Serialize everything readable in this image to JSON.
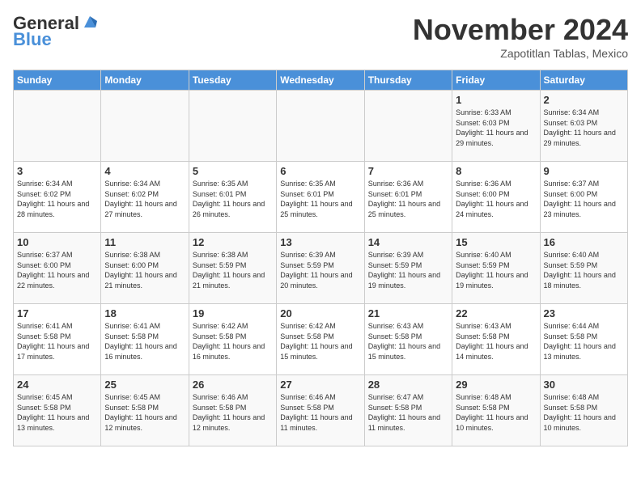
{
  "header": {
    "logo_general": "General",
    "logo_blue": "Blue",
    "month": "November 2024",
    "location": "Zapotitlan Tablas, Mexico"
  },
  "weekdays": [
    "Sunday",
    "Monday",
    "Tuesday",
    "Wednesday",
    "Thursday",
    "Friday",
    "Saturday"
  ],
  "weeks": [
    [
      {
        "day": "",
        "empty": true
      },
      {
        "day": "",
        "empty": true
      },
      {
        "day": "",
        "empty": true
      },
      {
        "day": "",
        "empty": true
      },
      {
        "day": "",
        "empty": true
      },
      {
        "day": "1",
        "sunrise": "Sunrise: 6:33 AM",
        "sunset": "Sunset: 6:03 PM",
        "daylight": "Daylight: 11 hours and 29 minutes."
      },
      {
        "day": "2",
        "sunrise": "Sunrise: 6:34 AM",
        "sunset": "Sunset: 6:03 PM",
        "daylight": "Daylight: 11 hours and 29 minutes."
      }
    ],
    [
      {
        "day": "3",
        "sunrise": "Sunrise: 6:34 AM",
        "sunset": "Sunset: 6:02 PM",
        "daylight": "Daylight: 11 hours and 28 minutes."
      },
      {
        "day": "4",
        "sunrise": "Sunrise: 6:34 AM",
        "sunset": "Sunset: 6:02 PM",
        "daylight": "Daylight: 11 hours and 27 minutes."
      },
      {
        "day": "5",
        "sunrise": "Sunrise: 6:35 AM",
        "sunset": "Sunset: 6:01 PM",
        "daylight": "Daylight: 11 hours and 26 minutes."
      },
      {
        "day": "6",
        "sunrise": "Sunrise: 6:35 AM",
        "sunset": "Sunset: 6:01 PM",
        "daylight": "Daylight: 11 hours and 25 minutes."
      },
      {
        "day": "7",
        "sunrise": "Sunrise: 6:36 AM",
        "sunset": "Sunset: 6:01 PM",
        "daylight": "Daylight: 11 hours and 25 minutes."
      },
      {
        "day": "8",
        "sunrise": "Sunrise: 6:36 AM",
        "sunset": "Sunset: 6:00 PM",
        "daylight": "Daylight: 11 hours and 24 minutes."
      },
      {
        "day": "9",
        "sunrise": "Sunrise: 6:37 AM",
        "sunset": "Sunset: 6:00 PM",
        "daylight": "Daylight: 11 hours and 23 minutes."
      }
    ],
    [
      {
        "day": "10",
        "sunrise": "Sunrise: 6:37 AM",
        "sunset": "Sunset: 6:00 PM",
        "daylight": "Daylight: 11 hours and 22 minutes."
      },
      {
        "day": "11",
        "sunrise": "Sunrise: 6:38 AM",
        "sunset": "Sunset: 6:00 PM",
        "daylight": "Daylight: 11 hours and 21 minutes."
      },
      {
        "day": "12",
        "sunrise": "Sunrise: 6:38 AM",
        "sunset": "Sunset: 5:59 PM",
        "daylight": "Daylight: 11 hours and 21 minutes."
      },
      {
        "day": "13",
        "sunrise": "Sunrise: 6:39 AM",
        "sunset": "Sunset: 5:59 PM",
        "daylight": "Daylight: 11 hours and 20 minutes."
      },
      {
        "day": "14",
        "sunrise": "Sunrise: 6:39 AM",
        "sunset": "Sunset: 5:59 PM",
        "daylight": "Daylight: 11 hours and 19 minutes."
      },
      {
        "day": "15",
        "sunrise": "Sunrise: 6:40 AM",
        "sunset": "Sunset: 5:59 PM",
        "daylight": "Daylight: 11 hours and 19 minutes."
      },
      {
        "day": "16",
        "sunrise": "Sunrise: 6:40 AM",
        "sunset": "Sunset: 5:59 PM",
        "daylight": "Daylight: 11 hours and 18 minutes."
      }
    ],
    [
      {
        "day": "17",
        "sunrise": "Sunrise: 6:41 AM",
        "sunset": "Sunset: 5:58 PM",
        "daylight": "Daylight: 11 hours and 17 minutes."
      },
      {
        "day": "18",
        "sunrise": "Sunrise: 6:41 AM",
        "sunset": "Sunset: 5:58 PM",
        "daylight": "Daylight: 11 hours and 16 minutes."
      },
      {
        "day": "19",
        "sunrise": "Sunrise: 6:42 AM",
        "sunset": "Sunset: 5:58 PM",
        "daylight": "Daylight: 11 hours and 16 minutes."
      },
      {
        "day": "20",
        "sunrise": "Sunrise: 6:42 AM",
        "sunset": "Sunset: 5:58 PM",
        "daylight": "Daylight: 11 hours and 15 minutes."
      },
      {
        "day": "21",
        "sunrise": "Sunrise: 6:43 AM",
        "sunset": "Sunset: 5:58 PM",
        "daylight": "Daylight: 11 hours and 15 minutes."
      },
      {
        "day": "22",
        "sunrise": "Sunrise: 6:43 AM",
        "sunset": "Sunset: 5:58 PM",
        "daylight": "Daylight: 11 hours and 14 minutes."
      },
      {
        "day": "23",
        "sunrise": "Sunrise: 6:44 AM",
        "sunset": "Sunset: 5:58 PM",
        "daylight": "Daylight: 11 hours and 13 minutes."
      }
    ],
    [
      {
        "day": "24",
        "sunrise": "Sunrise: 6:45 AM",
        "sunset": "Sunset: 5:58 PM",
        "daylight": "Daylight: 11 hours and 13 minutes."
      },
      {
        "day": "25",
        "sunrise": "Sunrise: 6:45 AM",
        "sunset": "Sunset: 5:58 PM",
        "daylight": "Daylight: 11 hours and 12 minutes."
      },
      {
        "day": "26",
        "sunrise": "Sunrise: 6:46 AM",
        "sunset": "Sunset: 5:58 PM",
        "daylight": "Daylight: 11 hours and 12 minutes."
      },
      {
        "day": "27",
        "sunrise": "Sunrise: 6:46 AM",
        "sunset": "Sunset: 5:58 PM",
        "daylight": "Daylight: 11 hours and 11 minutes."
      },
      {
        "day": "28",
        "sunrise": "Sunrise: 6:47 AM",
        "sunset": "Sunset: 5:58 PM",
        "daylight": "Daylight: 11 hours and 11 minutes."
      },
      {
        "day": "29",
        "sunrise": "Sunrise: 6:48 AM",
        "sunset": "Sunset: 5:58 PM",
        "daylight": "Daylight: 11 hours and 10 minutes."
      },
      {
        "day": "30",
        "sunrise": "Sunrise: 6:48 AM",
        "sunset": "Sunset: 5:58 PM",
        "daylight": "Daylight: 11 hours and 10 minutes."
      }
    ]
  ]
}
